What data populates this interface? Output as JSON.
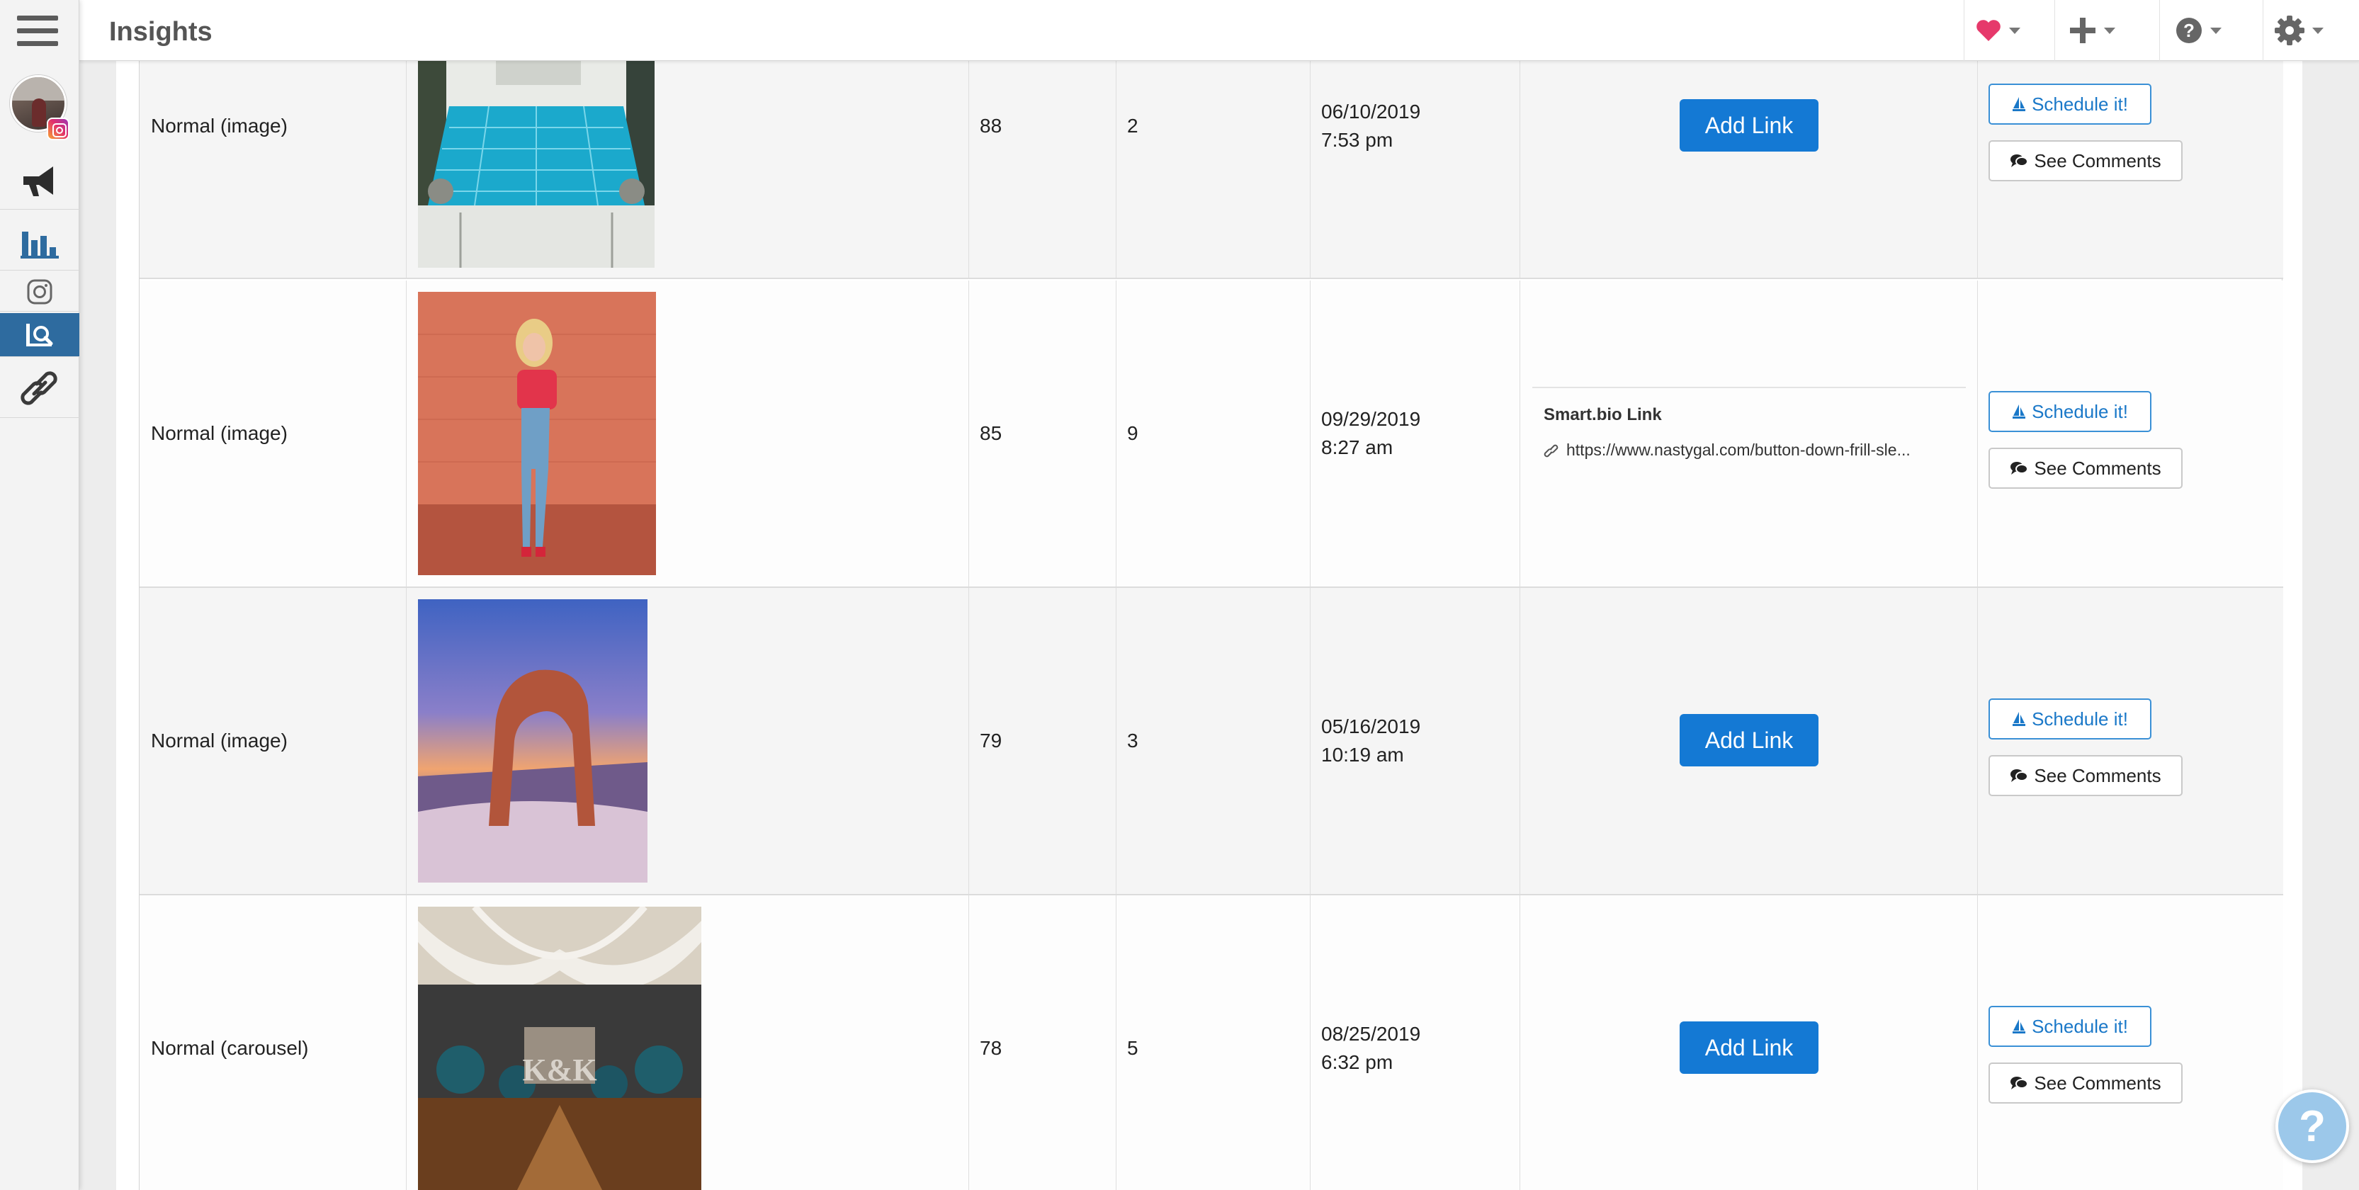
{
  "header": {
    "title": "Insights"
  },
  "rail": {
    "items": [
      "menu",
      "account-avatar",
      "campaigns",
      "analytics",
      "instagram",
      "insights",
      "links"
    ]
  },
  "topbar": {
    "icons": [
      "heart-icon",
      "plus-icon",
      "help-circle-icon",
      "gear-icon"
    ],
    "accent_heart": "#e6396b"
  },
  "rows": [
    {
      "type": "Normal (image)",
      "likes": "88",
      "comments": "2",
      "date": "06/10/2019",
      "time": "7:53 pm",
      "link_action": "Add Link",
      "schedule_label": "Schedule it!",
      "see_comments_label": "See Comments"
    },
    {
      "type": "Normal (image)",
      "likes": "85",
      "comments": "9",
      "date": "09/29/2019",
      "time": "8:27 am",
      "link_title": "Smart.bio Link",
      "link_url": "https://www.nastygal.com/button-down-frill-sle...",
      "schedule_label": "Schedule it!",
      "see_comments_label": "See Comments"
    },
    {
      "type": "Normal (image)",
      "likes": "79",
      "comments": "3",
      "date": "05/16/2019",
      "time": "10:19 am",
      "link_action": "Add Link",
      "schedule_label": "Schedule it!",
      "see_comments_label": "See Comments"
    },
    {
      "type": "Normal (carousel)",
      "likes": "78",
      "comments": "5",
      "date": "08/25/2019",
      "time": "6:32 pm",
      "link_action": "Add Link",
      "schedule_label": "Schedule it!",
      "see_comments_label": "See Comments"
    }
  ],
  "help_fab": {
    "label": "?"
  },
  "colors": {
    "primary": "#1479d4",
    "rail_active": "#2e6b9f",
    "outline_blue": "#3a90d6"
  }
}
